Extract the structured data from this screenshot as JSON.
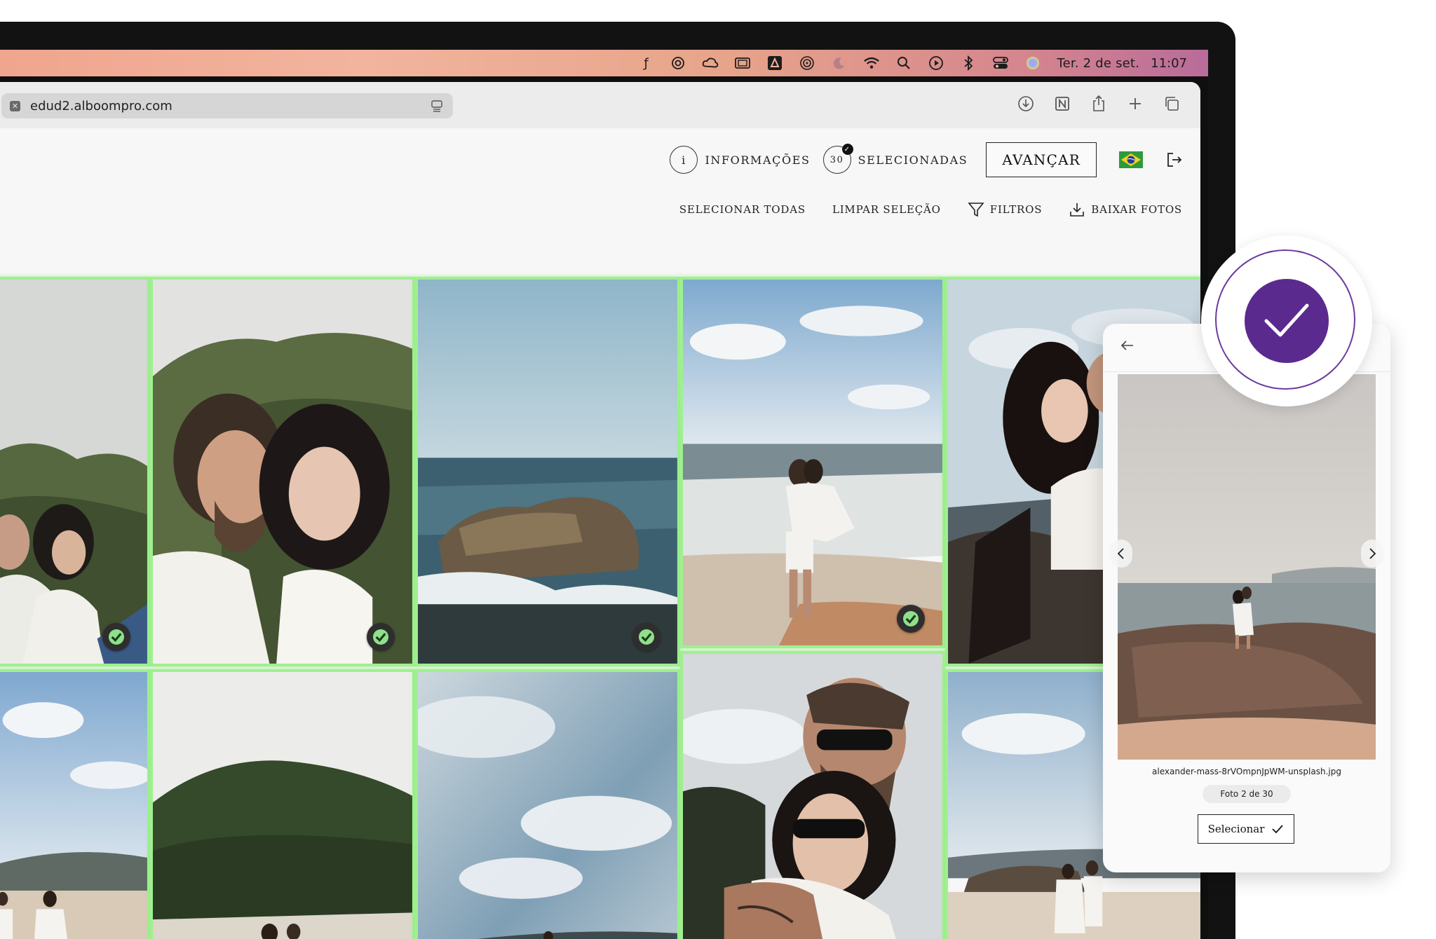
{
  "menubar": {
    "date": "Ter. 2 de set.",
    "time": "11:07",
    "icons": [
      "figma-icon",
      "chatgpt-icon",
      "creative-cloud-icon",
      "window-icon",
      "affinity-icon",
      "airdrop-icon",
      "moon-icon",
      "wifi-icon",
      "search-icon",
      "play-icon",
      "bluetooth-icon",
      "control-center-icon",
      "siri-icon"
    ]
  },
  "browser": {
    "url": "edud2.alboompro.com",
    "toolbar_icons": [
      "download-icon",
      "notion-icon",
      "share-icon",
      "new-tab-icon",
      "tabs-icon"
    ]
  },
  "site": {
    "nav": {
      "info_icon_letter": "i",
      "info_label": "INFORMAÇÕES",
      "selected_count": "30",
      "selected_label": "SELECIONADAS",
      "advance_label": "AVANÇAR"
    },
    "actions": {
      "select_all": "SELECIONAR TODAS",
      "clear_selection": "LIMPAR SELEÇÃO",
      "filters": "FILTROS",
      "download": "BAIXAR FOTOS"
    }
  },
  "gallery": {
    "selected_color": "#9ff08f",
    "photos": [
      {
        "selected": true,
        "scene": "couple-hill"
      },
      {
        "selected": true,
        "scene": "couple-closeup"
      },
      {
        "selected": true,
        "scene": "rock-sea"
      },
      {
        "selected": true,
        "scene": "beach-carry"
      },
      {
        "selected": true,
        "scene": "couple-rocks"
      },
      {
        "selected": true,
        "scene": "beach-dance"
      },
      {
        "selected": true,
        "scene": "green-hill"
      },
      {
        "selected": true,
        "scene": "sky-clouds"
      },
      {
        "selected": true,
        "scene": "sunglasses-hug"
      },
      {
        "selected": true,
        "scene": "beach-walk"
      }
    ]
  },
  "preview_panel": {
    "filename": "alexander-mass-8rVOmpnJpWM-unsplash.jpg",
    "counter": "Foto 2 de 30",
    "select_label": "Selecionar"
  },
  "brand": {
    "accent": "#5b2a8e"
  }
}
